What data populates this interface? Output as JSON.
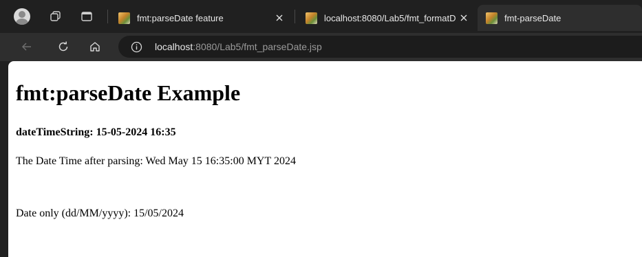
{
  "browser": {
    "tabs": [
      {
        "title": "fmt:parseDate feature",
        "active": false
      },
      {
        "title": "localhost:8080/Lab5/fmt_formatD",
        "active": false
      },
      {
        "title": "fmt-parseDate",
        "active": true
      }
    ],
    "address_bar": {
      "host": "localhost",
      "rest": ":8080/Lab5/fmt_parseDate.jsp"
    }
  },
  "page": {
    "heading": "fmt:parseDate Example",
    "datetime_string": "dateTimeString: 15-05-2024 16:35",
    "parsed_line": "The Date Time after parsing: Wed May 15 16:35:00 MYT 2024",
    "date_only_line": "Date only (dd/MM/yyyy): 15/05/2024"
  },
  "colors": {
    "chrome_dark": "#202020",
    "toolbar": "#2e2e2e",
    "omnibox": "#1c1c1c",
    "page_bg": "#ffffff"
  }
}
